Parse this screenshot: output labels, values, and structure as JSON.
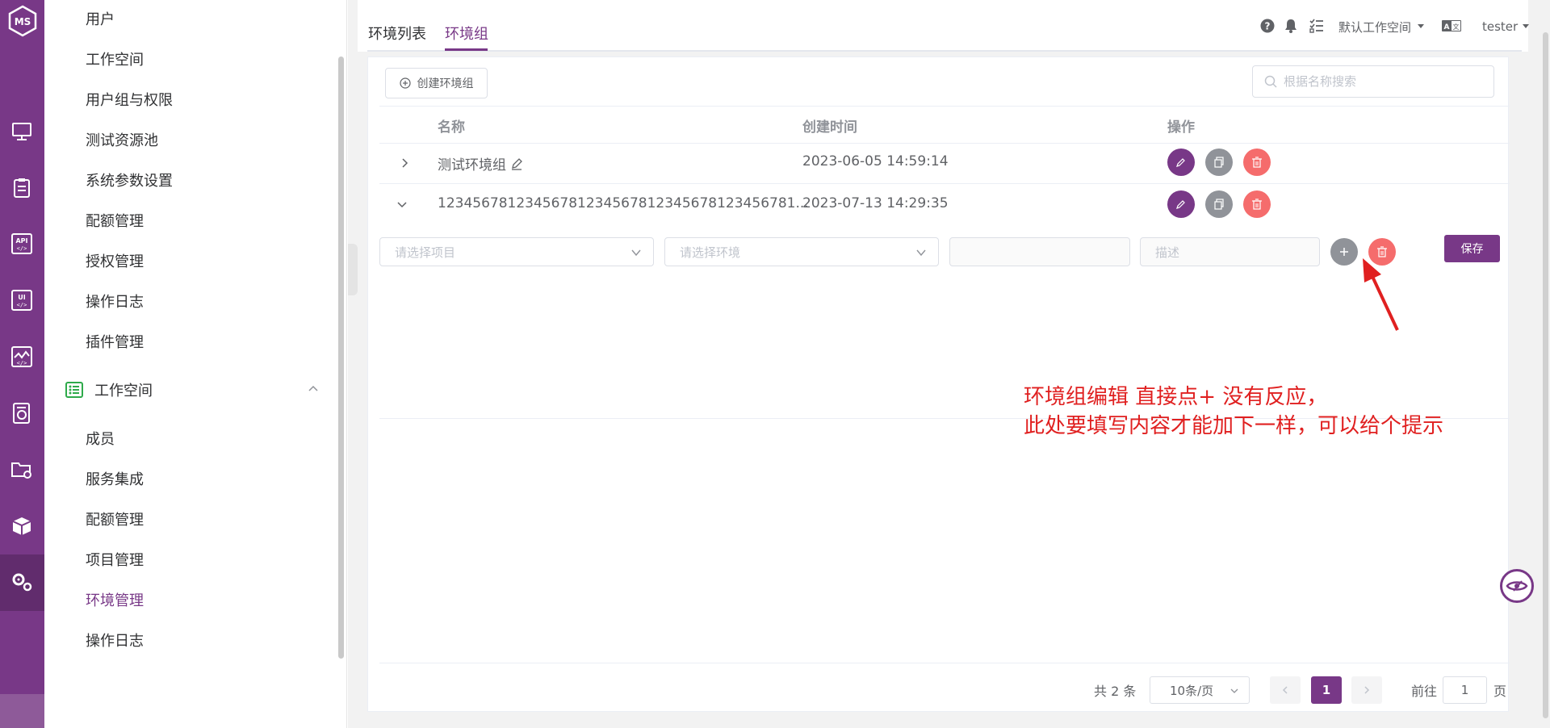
{
  "rail": {
    "logo": "MS",
    "icons": [
      "monitor-icon",
      "clipboard-icon",
      "api-icon",
      "ui-icon",
      "performance-icon",
      "report-icon",
      "folder-settings-icon",
      "cube-icon",
      "gears-icon"
    ],
    "accent": "#783887"
  },
  "menu": {
    "system_items": [
      "用户",
      "工作空间",
      "用户组与权限",
      "测试资源池",
      "系统参数设置",
      "配额管理",
      "授权管理",
      "操作日志",
      "插件管理"
    ],
    "group_label": "工作空间",
    "workspace_items": [
      "成员",
      "服务集成",
      "配额管理",
      "项目管理",
      "环境管理",
      "操作日志"
    ],
    "active_item": "环境管理"
  },
  "header": {
    "tabs": [
      "环境列表",
      "环境组"
    ],
    "active_tab": "环境组",
    "workspace": "默认工作空间",
    "user": "tester"
  },
  "toolbar": {
    "create_label": "创建环境组",
    "search_placeholder": "根据名称搜索"
  },
  "table": {
    "columns": [
      "名称",
      "创建时间",
      "操作"
    ],
    "rows": [
      {
        "name": "测试环境组",
        "created": "2023-06-05 14:59:14"
      },
      {
        "name": "12345678123456781234567812345678123456781...",
        "created": "2023-07-13 14:29:35"
      }
    ]
  },
  "expand": {
    "project_placeholder": "请选择项目",
    "env_placeholder": "请选择环境",
    "desc_placeholder": "描述",
    "save_label": "保存"
  },
  "annotation": {
    "line1": "环境组编辑 直接点+ 没有反应，",
    "line2": "此处要填写内容才能加下一样，可以给个提示"
  },
  "pagination": {
    "total": "共 2 条",
    "page_size": "10条/页",
    "current": "1",
    "goto_label": "前往",
    "goto_value": "1",
    "page_suffix": "页"
  }
}
